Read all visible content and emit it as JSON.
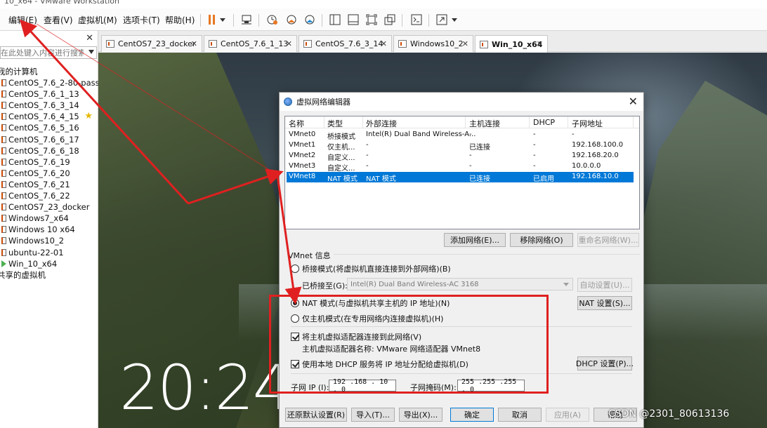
{
  "app": {
    "title": "10_x64 - VMware Workstation"
  },
  "menu": [
    {
      "label": "编辑(E)"
    },
    {
      "label": "查看(V)"
    },
    {
      "label": "虚拟机(M)"
    },
    {
      "label": "选项卡(T)"
    },
    {
      "label": "帮助(H)"
    }
  ],
  "toolbar_icons": [
    "pause-icon",
    "dropdown-icon",
    "send-keys-icon",
    "snapshot-icon",
    "revert-snapshot-icon",
    "snapshot-manager-icon",
    "library-view-icon",
    "console-view-icon",
    "fullscreen-icon",
    "unity-icon",
    "terminal-icon",
    "stretch-icon"
  ],
  "library": {
    "search_placeholder": "在此处键入内容进行搜索",
    "root": "我的计算机",
    "items": [
      "CentOS_7.6_2-80-pass",
      "CentOS_7.6_1_13",
      "CentOS_7.6_3_14",
      "CentOS_7.6_4_15",
      "CentOS_7.6_5_16",
      "CentOS_7.6_6_17",
      "CentOS_7.6_6_18",
      "CentOS_7.6_19",
      "CentOS_7.6_20",
      "CentOS_7.6_21",
      "CentOS_7.6_22",
      "CentOS7_23_docker",
      "Windows7_x64",
      "Windows 10 x64",
      "Windows10_2",
      "ubuntu-22-01",
      "Win_10_x64"
    ],
    "shared": "共享的虚拟机"
  },
  "tabs": [
    {
      "label": "CentOS7_23_docker"
    },
    {
      "label": "CentOS_7.6_1_13"
    },
    {
      "label": "CentOS_7.6_3_14"
    },
    {
      "label": "Windows10_2"
    },
    {
      "label": "Win_10_x64"
    }
  ],
  "desktop": {
    "clock": "20:24"
  },
  "dialog": {
    "title": "虚拟网络编辑器",
    "columns": [
      "名称",
      "类型",
      "外部连接",
      "主机连接",
      "DHCP",
      "子网地址"
    ],
    "rows": [
      [
        "VMnet0",
        "桥接模式",
        "Intel(R) Dual Band Wireless-A...",
        "-",
        "-",
        "-"
      ],
      [
        "VMnet1",
        "仅主机...",
        "-",
        "已连接",
        "-",
        "192.168.100.0"
      ],
      [
        "VMnet2",
        "自定义...",
        "-",
        "-",
        "-",
        "192.168.20.0"
      ],
      [
        "VMnet3",
        "自定义...",
        "-",
        "-",
        "-",
        "10.0.0.0"
      ],
      [
        "VMnet8",
        "NAT 模式",
        "NAT 模式",
        "已连接",
        "已启用",
        "192.168.10.0"
      ]
    ],
    "add_network": "添加网络(E)...",
    "remove_network": "移除网络(O)",
    "rename_network": "重命名网络(W)...",
    "group_title": "VMnet 信息",
    "bridge_mode": "桥接模式(将虚拟机直接连接到外部网络)(B)",
    "bridged_to_label": "已桥接至(G):",
    "bridged_to_value": "Intel(R) Dual Band Wireless-AC 3168",
    "auto_settings": "自动设置(U)...",
    "nat_mode": "NAT 模式(与虚拟机共享主机的 IP 地址)(N)",
    "nat_settings": "NAT 设置(S)...",
    "host_only_mode": "仅主机模式(在专用网络内连接虚拟机)(H)",
    "connect_adapter": "将主机虚拟适配器连接到此网络(V)",
    "adapter_name": "主机虚拟适配器名称: VMware 网络适配器 VMnet8",
    "use_dhcp": "使用本地 DHCP 服务将 IP 地址分配给虚拟机(D)",
    "dhcp_settings": "DHCP 设置(P)...",
    "subnet_ip_label": "子网 IP (I):",
    "subnet_ip": "192 .168 . 10 . 0",
    "subnet_mask_label": "子网掩码(M):",
    "subnet_mask": "255 .255 .255 . 0",
    "restore_defaults": "还原默认设置(R)",
    "import": "导入(T)...",
    "export": "导出(X)...",
    "ok": "确定",
    "cancel": "取消",
    "apply": "应用(A)",
    "help": "帮助"
  },
  "watermark": "CSDN @2301_80613136",
  "colors": {
    "annotation_red": "#e02020",
    "selection_blue": "#0078d7",
    "pause_orange": "#e87722"
  }
}
